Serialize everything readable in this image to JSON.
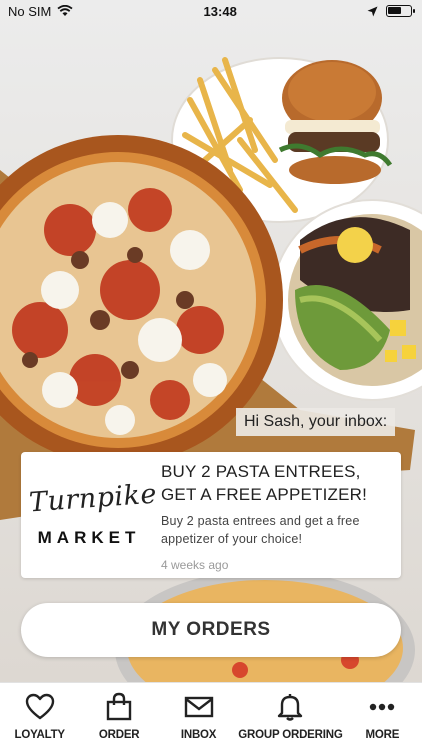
{
  "status_bar": {
    "carrier": "No SIM",
    "time": "13:48"
  },
  "inbox": {
    "greeting": "Hi Sash, your inbox:",
    "message": {
      "logo_script": "Turnpike",
      "logo_text": "MARKET",
      "title": "BUY 2 PASTA ENTREES, GET A FREE APPETIZER!",
      "body": "Buy 2 pasta entrees and get a free appetizer of your choice!",
      "time": "4 weeks ago"
    }
  },
  "actions": {
    "my_orders_label": "MY ORDERS"
  },
  "tabbar": {
    "items": [
      {
        "label": "LOYALTY",
        "icon": "heart-icon"
      },
      {
        "label": "ORDER",
        "icon": "bag-icon"
      },
      {
        "label": "INBOX",
        "icon": "envelope-icon"
      },
      {
        "label": "GROUP ORDERING",
        "icon": "bell-icon"
      },
      {
        "label": "MORE",
        "icon": "more-icon"
      }
    ]
  },
  "colors": {
    "text": "#222222",
    "accent": "#111111",
    "background": "#ffffff"
  }
}
